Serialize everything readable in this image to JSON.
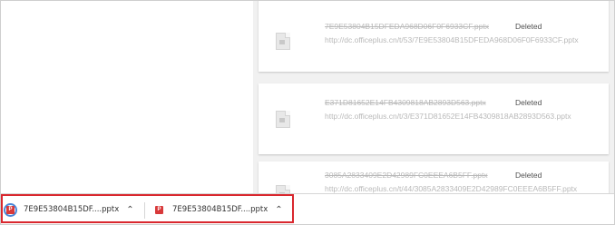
{
  "downloads_list": [
    {
      "filename": "7E9E53804B15DFEDA968D06F0F6933CF.pptx",
      "status": "Deleted",
      "url": "http://dc.officeplus.cn/t/53/7E9E53804B15DFEDA968D06F0F6933CF.pptx"
    },
    {
      "filename": "E371D81652E14FB4309818AB2893D563.pptx",
      "status": "Deleted",
      "url": "http://dc.officeplus.cn/t/3/E371D81652E14FB4309818AB2893D563.pptx"
    },
    {
      "filename": "3085A2833409E2D42989FC0EEEA6B5FF.pptx",
      "status": "Deleted",
      "url": "http://dc.officeplus.cn/t/44/3085A2833409E2D42989FC0EEEA6B5FF.pptx"
    }
  ],
  "download_bar": {
    "items": [
      {
        "name": "7E9E53804B15DF....pptx",
        "icon": "powerpoint-file-icon",
        "active": true
      },
      {
        "name": "7E9E53804B15DF....pptx",
        "icon": "powerpoint-file-icon",
        "active": false
      }
    ],
    "chevron": "⌃",
    "highlight_color": "#d9272e"
  },
  "colors": {
    "background": "#f1f1f1",
    "card": "#ffffff",
    "muted_text": "#b9b9b9",
    "status_text": "#505050",
    "progress_ring": "#4a86d8",
    "ppt_red": "#d8393a"
  }
}
